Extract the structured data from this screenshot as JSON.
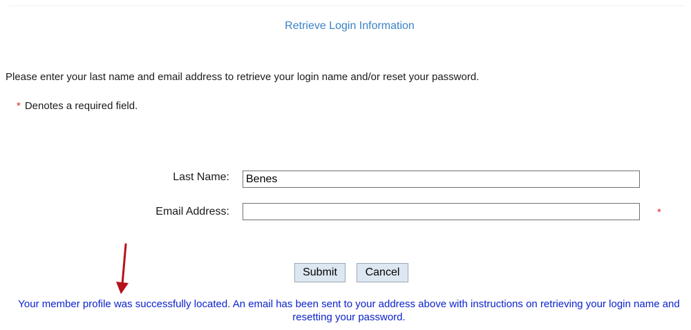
{
  "page": {
    "title": "Retrieve Login Information",
    "instructions": "Please enter your last name and email address to retrieve your login name and/or reset your password.",
    "required_note": {
      "star": "*",
      "text": "Denotes a required field."
    }
  },
  "form": {
    "last_name": {
      "label": "Last Name:",
      "value": "Benes"
    },
    "email": {
      "label": "Email Address:",
      "value": "",
      "required_star": "*"
    },
    "submit_label": "Submit",
    "cancel_label": "Cancel"
  },
  "message": {
    "success": "Your member profile was successfully located. An email has been sent to your address above with instructions on retrieving your login name and resetting your password."
  },
  "annotation": {
    "icon": "arrow-down-icon",
    "color": "#b5121b"
  },
  "colors": {
    "title": "#3b82c4",
    "required": "#e0282e",
    "success": "#0b22cc",
    "button_bg": "#dde7f1"
  }
}
